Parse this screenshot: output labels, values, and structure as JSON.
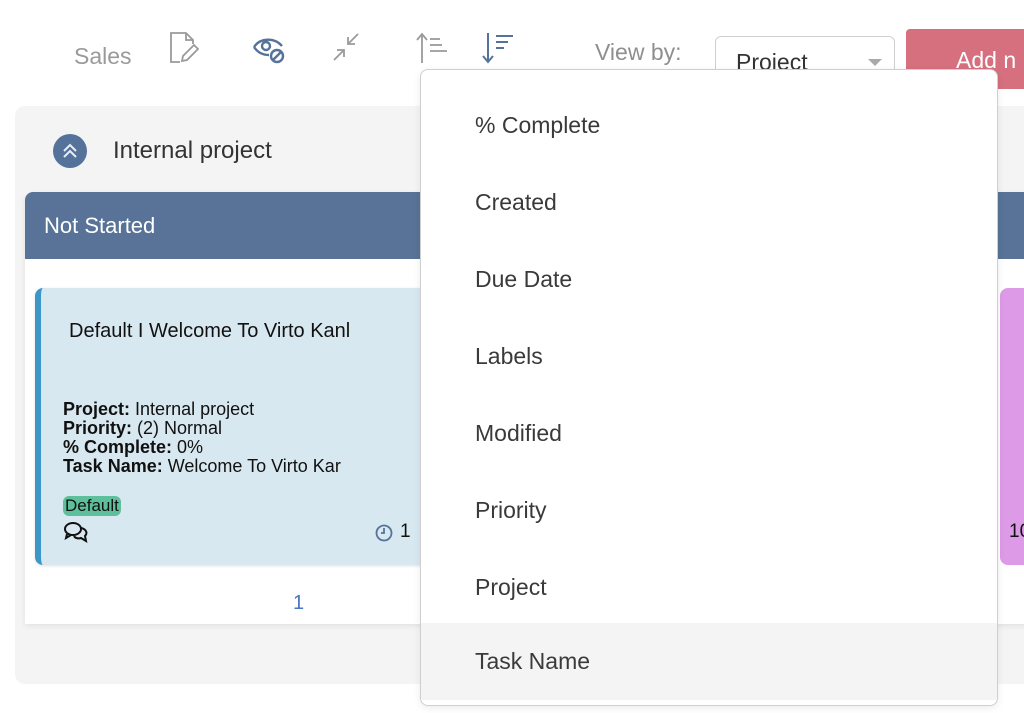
{
  "toolbar": {
    "board_name": "Sales",
    "icons": [
      "edit-document-icon",
      "hide-eye-icon",
      "collapse-arrows-icon",
      "sort-ascending-icon",
      "sort-descending-icon"
    ],
    "view_by_label": "View by:",
    "view_by_value": "Project",
    "add_button_label": "Add n"
  },
  "swimlane": {
    "title": "Internal project",
    "column": {
      "title": "Not Started",
      "cards": [
        {
          "title": "Default I Welcome To Virto Kanl",
          "fields": [
            {
              "label": "Project:",
              "value": "Internal project"
            },
            {
              "label": "Priority:",
              "value": "(2) Normal"
            },
            {
              "label": "% Complete:",
              "value": "0%"
            },
            {
              "label": "Task Name:",
              "value": "Welcome To Virto Kar"
            }
          ],
          "tag": "Default",
          "date": "1"
        },
        {
          "date": "10"
        }
      ],
      "page": "1"
    }
  },
  "dropdown": {
    "items": [
      "% Complete",
      "Created",
      "Due Date",
      "Labels",
      "Modified",
      "Priority",
      "Project",
      "Task Name"
    ],
    "hovered_index": 7
  },
  "colors": {
    "accent_blue": "#587397",
    "add_button": "#d6707e",
    "card_bg": "#d8e8f0",
    "card_border": "#3d96c8",
    "tag_bg": "#5ebf9c",
    "card2_bg": "#dd9ae6",
    "pager": "#4a75c0"
  }
}
